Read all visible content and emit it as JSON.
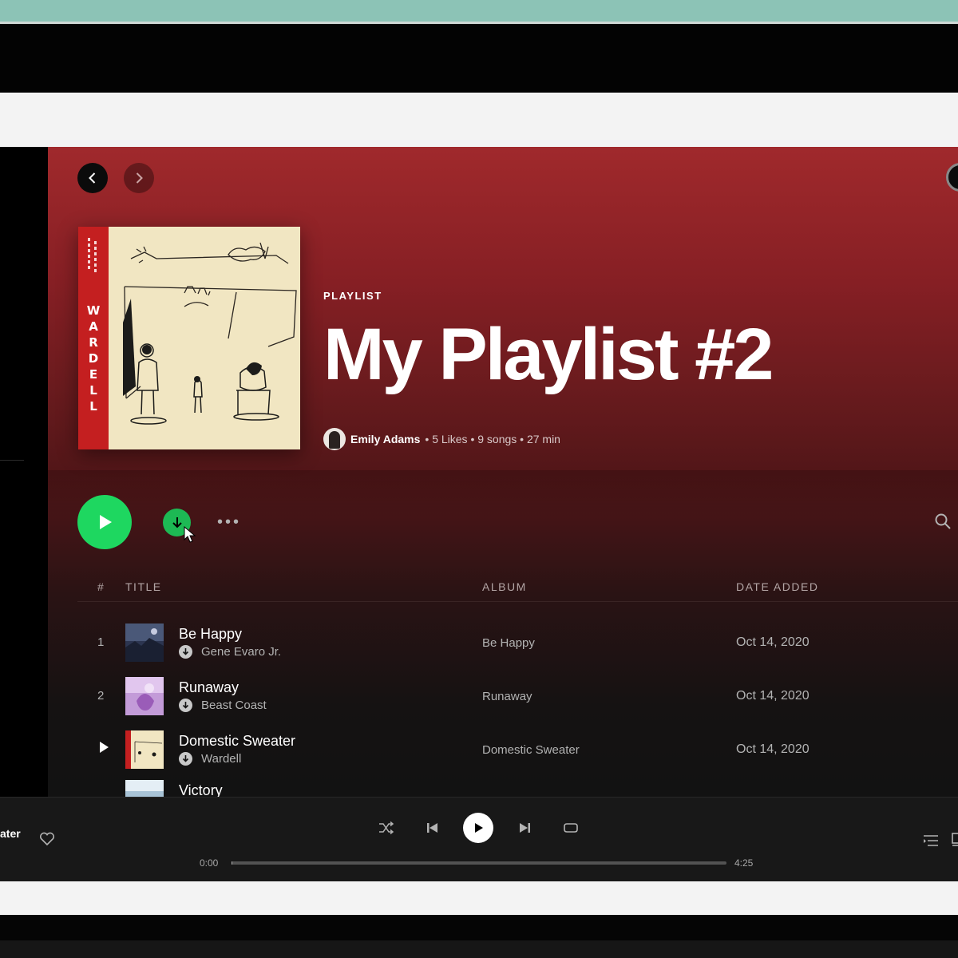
{
  "nav": {
    "back_icon": "chevron-left-icon",
    "forward_icon": "chevron-right-icon"
  },
  "playlist": {
    "kicker": "PLAYLIST",
    "title": "My Playlist #2",
    "owner": "Emily Adams",
    "stats": "• 5 Likes • 9 songs • 27 min",
    "cover": {
      "spine_text": "WARDELL"
    }
  },
  "actions": {
    "play_icon": "play-icon",
    "download_icon": "download-icon",
    "more_label": "•••",
    "search_icon": "search-icon"
  },
  "table": {
    "headers": {
      "num": "#",
      "title": "TITLE",
      "album": "ALBUM",
      "date": "DATE ADDED"
    },
    "rows": [
      {
        "num": "1",
        "title": "Be Happy",
        "artist": "Gene Evaro Jr.",
        "album": "Be Happy",
        "date": "Oct 14, 2020"
      },
      {
        "num": "2",
        "title": "Runaway",
        "artist": "Beast Coast",
        "album": "Runaway",
        "date": "Oct 14, 2020"
      },
      {
        "num": "",
        "title": "Domestic Sweater",
        "artist": "Wardell",
        "album": "Domestic Sweater",
        "date": "Oct 14, 2020"
      },
      {
        "num": "",
        "title": "Victory",
        "artist": "",
        "album": "",
        "date": ""
      }
    ]
  },
  "player": {
    "now_playing": "ater",
    "time_current": "0:00",
    "time_total": "4:25",
    "progress": 0.0
  },
  "colors": {
    "accent": "#1ed760",
    "header_red": "#a0292c",
    "background": "#121212"
  }
}
